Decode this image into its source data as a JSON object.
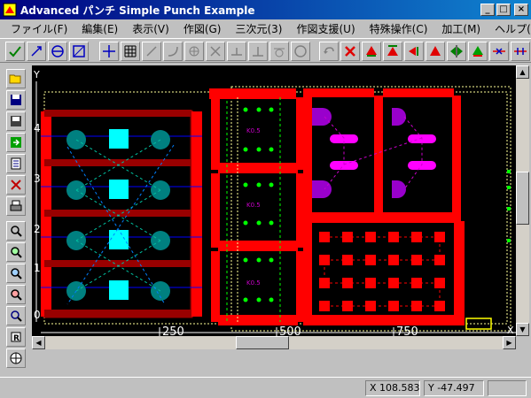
{
  "window": {
    "title": "Advanced パンチ Simple Punch Example",
    "min_glyph": "_",
    "max_glyph": "□",
    "close_glyph": "×"
  },
  "menu": [
    "ファイル(F)",
    "編集(E)",
    "表示(V)",
    "作図(G)",
    "三次元(3)",
    "作図支援(U)",
    "特殊操作(C)",
    "加工(M)",
    "ヘルプ(H)"
  ],
  "toolbar_icons": [
    "check-line-icon",
    "arrow-line-icon",
    "circle-minus-icon",
    "square-zoom-icon",
    "move-cross-icon",
    "grid-icon",
    "line-tool-icon",
    "arc-tool-icon",
    "snap-center-icon",
    "snap-intersect-icon",
    "snap-midpoint-icon",
    "snap-perpendicular-icon",
    "snap-tangent-icon",
    "snap-end-icon",
    "undo-icon",
    "delete-x-icon",
    "punch-up-icon",
    "punch-down-icon",
    "punch-left-icon",
    "punch-triangle-icon",
    "mirror-icon",
    "punch-up-green-icon",
    "split-icon",
    "link-icon",
    "right-arrow-icon"
  ],
  "left_tools": [
    "open-folder-icon",
    "save-icon",
    "save-as-icon",
    "export-icon",
    "document-icon",
    "cut-icon",
    "print-icon",
    "zoom-icon",
    "zoom-in-icon",
    "zoom-fit-icon",
    "zoom-out-icon",
    "pan-icon",
    "redraw-icon",
    "compass-icon"
  ],
  "canvas": {
    "axis_y_label": "Y",
    "axis_x_label": "X",
    "y_ticks": [
      "4",
      "3",
      "2",
      "1",
      "0"
    ],
    "x_ticks": [
      "250",
      "500",
      "750"
    ],
    "hole_labels": [
      "K0.5",
      "K0.5",
      "K0.5"
    ],
    "colors": {
      "bg": "#000000",
      "frame": "#ff0000",
      "bar": "#8b0000",
      "circle": "#008080",
      "square": "#00ffff",
      "purple": "#cc00cc",
      "green": "#00ff00",
      "dash_yellow": "#ffff99",
      "dark_red": "#990000"
    }
  },
  "status": {
    "x": "X 108.583",
    "y": "Y -47.497"
  }
}
